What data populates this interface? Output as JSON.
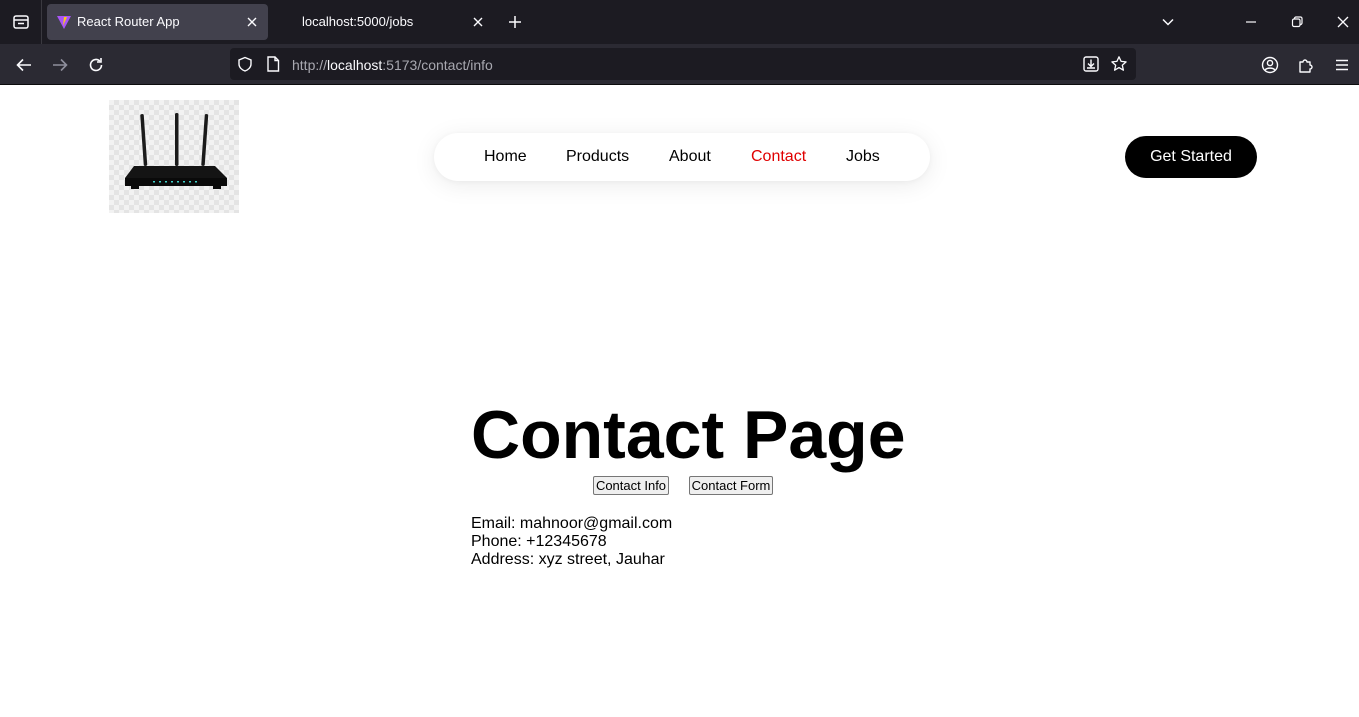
{
  "browser": {
    "tabs": [
      {
        "title": "React Router App",
        "active": true,
        "icon": "vite-icon"
      },
      {
        "title": "localhost:5000/jobs",
        "active": false
      }
    ],
    "url": {
      "scheme": "http://",
      "host": "localhost",
      "rest": ":5173/contact/info"
    }
  },
  "header": {
    "logo": "router-image",
    "nav": [
      {
        "label": "Home",
        "active": false
      },
      {
        "label": "Products",
        "active": false
      },
      {
        "label": "About",
        "active": false
      },
      {
        "label": "Contact",
        "active": true
      },
      {
        "label": "Jobs",
        "active": false
      }
    ],
    "cta_label": "Get Started"
  },
  "contact": {
    "title": "Contact Page",
    "buttons": [
      "Contact Info",
      "Contact Form"
    ],
    "info": {
      "email": "Email: mahnoor@gmail.com",
      "phone": "Phone: +12345678",
      "address": "Address: xyz street, Jauhar"
    }
  },
  "colors": {
    "active_link": "#e00000",
    "chrome_bg": "#1c1b22",
    "toolbar_bg": "#2b2a33",
    "cta_bg": "#000000"
  }
}
